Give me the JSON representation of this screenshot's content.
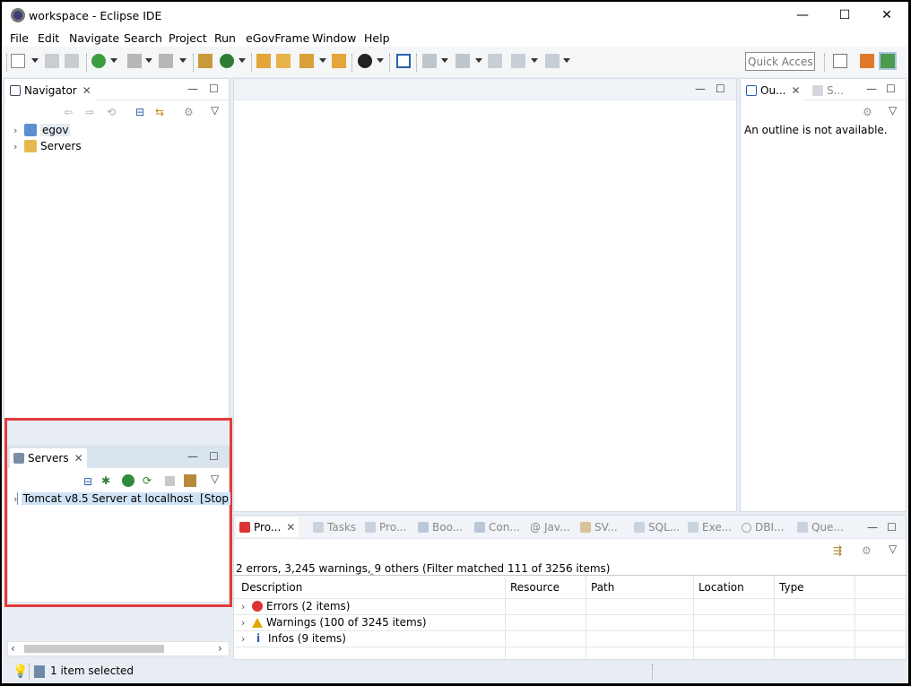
{
  "window": {
    "title": "workspace - Eclipse IDE",
    "controls": [
      "—",
      "☐",
      "✕"
    ]
  },
  "menu": [
    "File",
    "Edit",
    "Navigate",
    "Search",
    "Project",
    "Run",
    "eGovFrame",
    "Window",
    "Help"
  ],
  "quick_access": {
    "placeholder": "Quick Access"
  },
  "navigator": {
    "tab_label": "Navigator",
    "items": [
      {
        "label": "egov"
      },
      {
        "label": "Servers"
      }
    ]
  },
  "servers": {
    "tab_label": "Servers",
    "items": [
      {
        "label": "Tomcat v8.5 Server at localhost  [Stop"
      }
    ]
  },
  "outline": {
    "tab_label": "Ou...",
    "tab2_label": "S...",
    "message": "An outline is not available."
  },
  "bottom": {
    "tabs": [
      "Pro...",
      "Tasks",
      "Pro...",
      "Boo...",
      "Con...",
      "Jav...",
      "SV...",
      "SQL...",
      "Exe...",
      "DBI...",
      "Que..."
    ],
    "summary": "2 errors, 3,245 warnings, 9 others (Filter matched 111 of 3256 items)",
    "columns": [
      "Description",
      "Resource",
      "Path",
      "Location",
      "Type"
    ],
    "rows": [
      {
        "label": "Errors (2 items)",
        "icon": "error-icon"
      },
      {
        "label": "Warnings (100 of 3245 items)",
        "icon": "warning-icon"
      },
      {
        "label": "Infos (9 items)",
        "icon": "info-icon"
      }
    ]
  },
  "status": {
    "text": "1 item selected"
  },
  "colors": {
    "highlight": "#e23b3b",
    "selection": "#cfe3f7",
    "accent": "#2e7d32"
  }
}
